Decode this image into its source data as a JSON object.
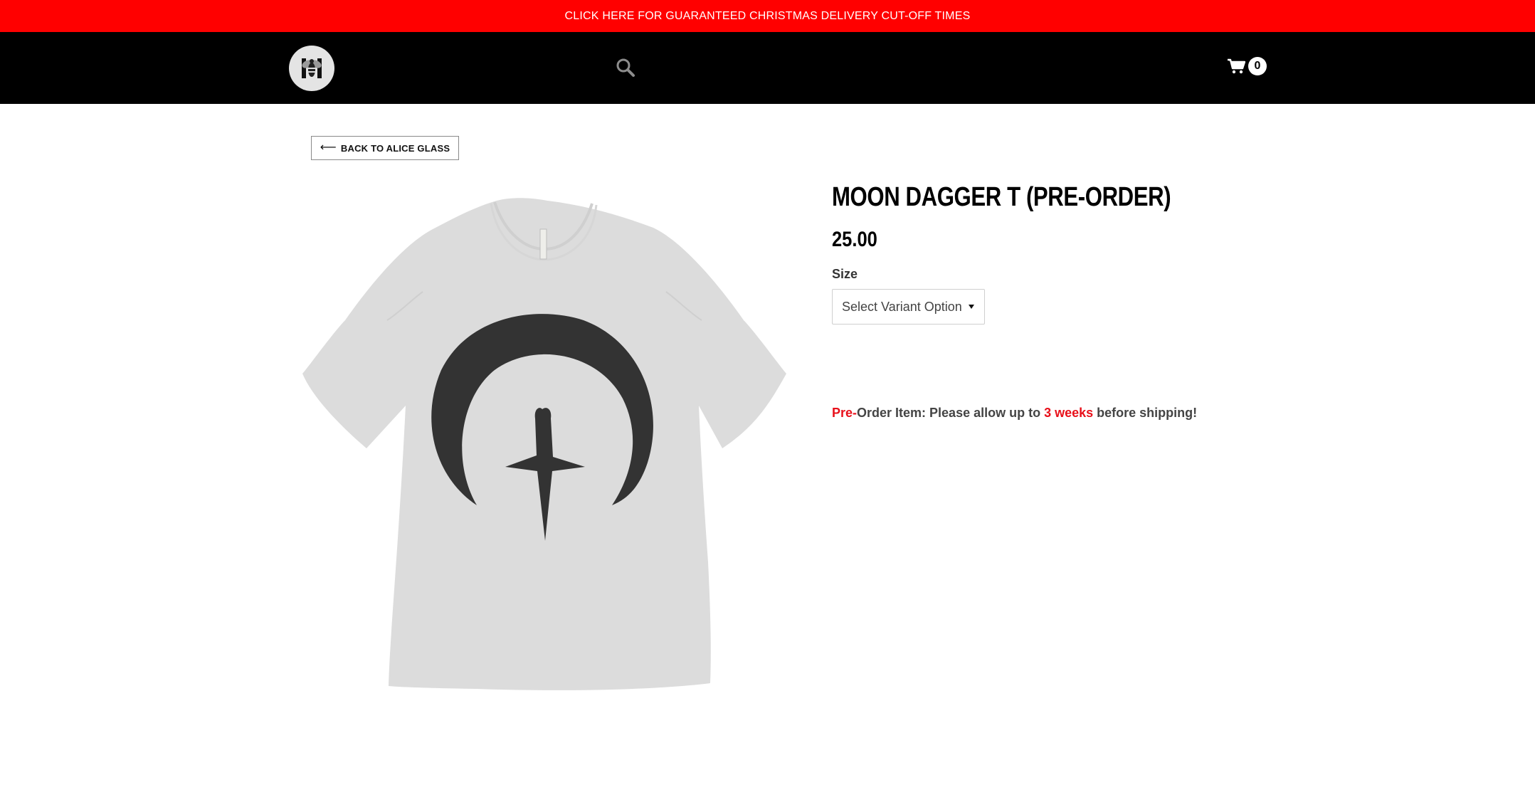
{
  "promo": {
    "text": "CLICK HERE FOR GUARANTEED CHRISTMAS DELIVERY CUT-OFF TIMES",
    "color": "#ff0000"
  },
  "header": {
    "logo_icon": "bee-logo-icon",
    "search_icon": "search-icon",
    "cart_icon": "cart-icon",
    "cart_count": "0"
  },
  "back": {
    "arrow": "⟵",
    "label": "BACK TO ALICE GLASS"
  },
  "product": {
    "title": "MOON DAGGER T (PRE-ORDER)",
    "price": "25.00",
    "image": "moon-dagger-tshirt-image",
    "size_label": "Size",
    "variant_select": {
      "selected": "Select Variant Option"
    },
    "preorder_note": {
      "pre": "Pre-",
      "part1": "Order Item: Please allow up to ",
      "weeks": "3 weeks",
      "part2": " before shipping!"
    }
  },
  "colors": {
    "accent_red": "#e8101a",
    "header_bg": "#000000"
  }
}
